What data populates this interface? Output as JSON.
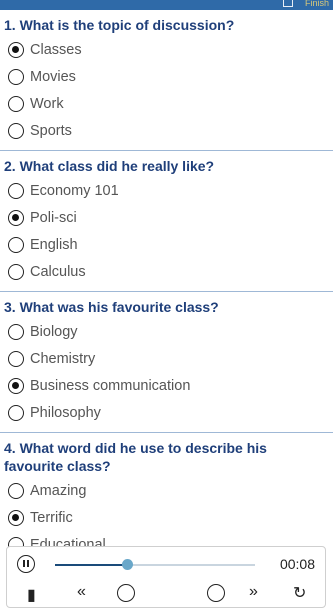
{
  "header": {
    "title_fragment": "",
    "finish_label": "Finish"
  },
  "questions": [
    {
      "text": "1. What is the topic of discussion?",
      "options": [
        {
          "label": "Classes",
          "checked": true
        },
        {
          "label": "Movies",
          "checked": false
        },
        {
          "label": "Work",
          "checked": false
        },
        {
          "label": "Sports",
          "checked": false
        }
      ]
    },
    {
      "text": "2. What class did he really like?",
      "options": [
        {
          "label": "Economy 101",
          "checked": false
        },
        {
          "label": "Poli-sci",
          "checked": true
        },
        {
          "label": "English",
          "checked": false
        },
        {
          "label": "Calculus",
          "checked": false
        }
      ]
    },
    {
      "text": "3. What was his favourite class?",
      "options": [
        {
          "label": "Biology",
          "checked": false
        },
        {
          "label": "Chemistry",
          "checked": false
        },
        {
          "label": "Business communication",
          "checked": true
        },
        {
          "label": "Philosophy",
          "checked": false
        }
      ]
    },
    {
      "text": "4. What word did he use to describe his favourite class?",
      "options": [
        {
          "label": "Amazing",
          "checked": false
        },
        {
          "label": "Terrific",
          "checked": true
        },
        {
          "label": "Educational",
          "checked": false
        }
      ]
    }
  ],
  "player": {
    "time": "00:08",
    "progress": 0.36,
    "colors": {
      "track": "#c9d5df",
      "fill": "#1a4b7a",
      "thumb": "#69a7c9"
    }
  },
  "colors": {
    "header_bg": "#2f6aa8",
    "question_text": "#1f3f7a",
    "divider": "#9fb8d6"
  }
}
